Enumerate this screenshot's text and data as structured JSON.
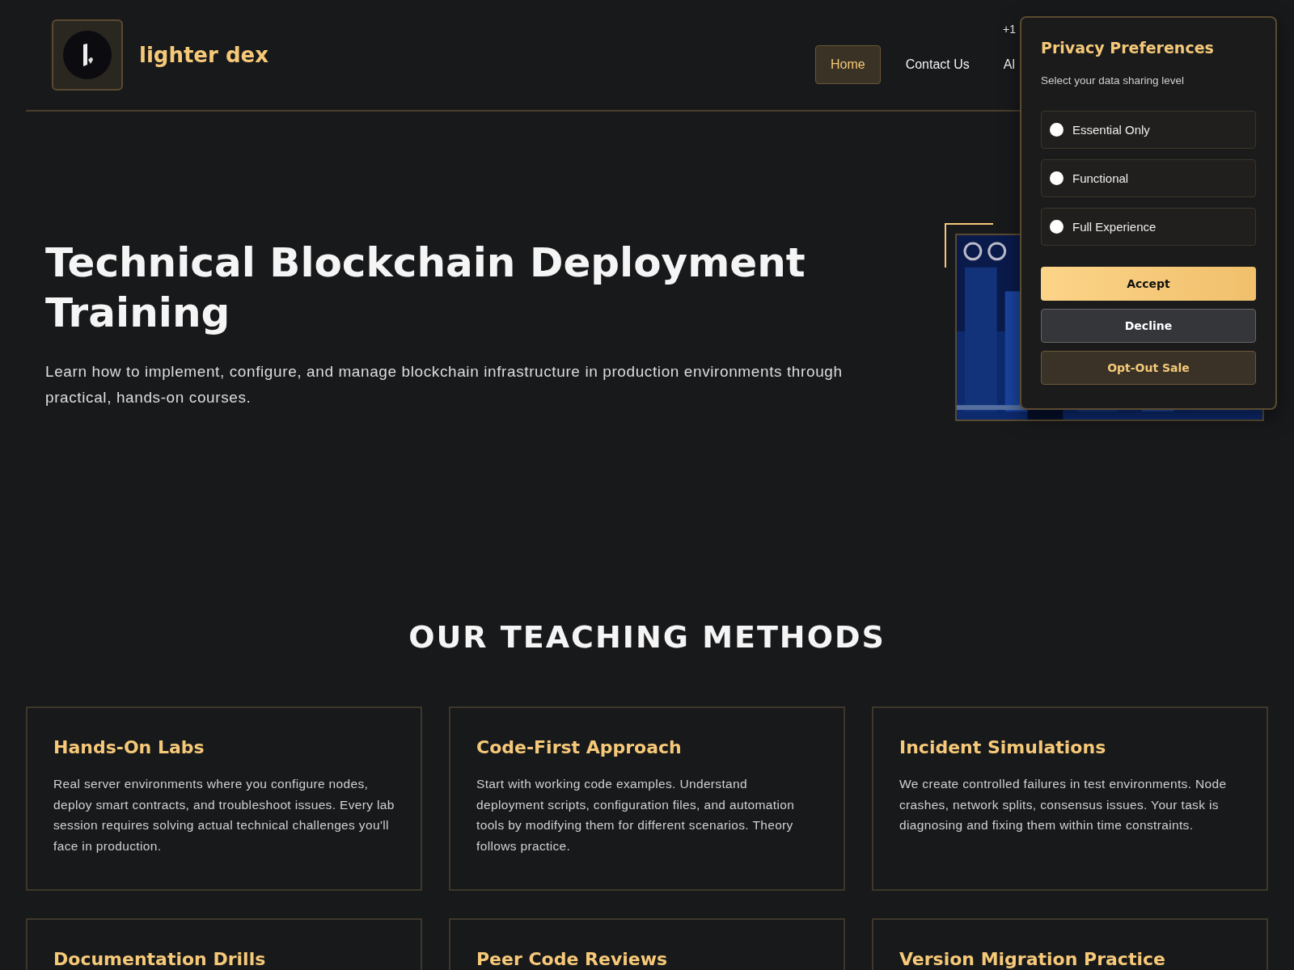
{
  "header": {
    "brand": "lighter dex",
    "phone": "+1",
    "nav": [
      {
        "label": "Home",
        "selected": true
      },
      {
        "label": "Contact Us",
        "selected": false
      },
      {
        "label": "Al",
        "selected": false
      }
    ]
  },
  "hero": {
    "title": "Technical Blockchain Deployment Training",
    "text": "Learn how to implement, configure, and manage blockchain infrastructure in production environments through practical, hands-on courses."
  },
  "privacy": {
    "title": "Privacy Preferences",
    "subtitle": "Select your data sharing level",
    "options": [
      {
        "label": "Essential Only",
        "selected": false
      },
      {
        "label": "Functional",
        "selected": false
      },
      {
        "label": "Full Experience",
        "selected": false
      }
    ],
    "buttons": [
      {
        "label": "Accept",
        "kind": "primary"
      },
      {
        "label": "Decline",
        "kind": "secondary"
      },
      {
        "label": "Opt-Out Sale",
        "kind": "outline"
      }
    ]
  },
  "methods": {
    "heading": "OUR TEACHING METHODS",
    "cards": [
      {
        "title": "Hands-On Labs",
        "text": "Real server environments where you configure nodes, deploy smart contracts, and troubleshoot issues. Every lab session requires solving actual technical challenges you'll face in production."
      },
      {
        "title": "Code-First Approach",
        "text": "Start with working code examples. Understand deployment scripts, configuration files, and automation tools by modifying them for different scenarios. Theory follows practice."
      },
      {
        "title": "Incident Simulations",
        "text": "We create controlled failures in test environments. Node crashes, network splits, consensus issues. Your task is diagnosing and fixing them within time constraints."
      },
      {
        "title": "Documentation Drills"
      },
      {
        "title": "Peer Code Reviews"
      },
      {
        "title": "Version Migration Practice"
      }
    ]
  }
}
